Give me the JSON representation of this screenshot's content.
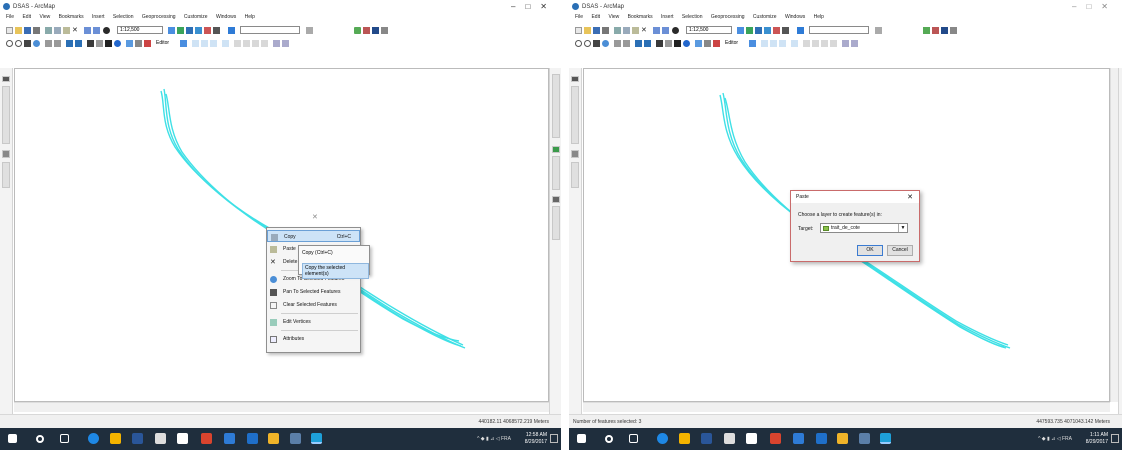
{
  "left": {
    "window": {
      "title": "DSAS - ArcMap"
    },
    "menu": [
      "File",
      "Edit",
      "View",
      "Bookmarks",
      "Insert",
      "Selection",
      "Geoprocessing",
      "Customize",
      "Windows",
      "Help"
    ],
    "toolbar": {
      "scale": "1:12,500",
      "editor_label": "Editor"
    },
    "context_menu": {
      "items": [
        {
          "label": "Copy",
          "shortcut": "Ctrl+C",
          "icon": "copy-icon"
        },
        {
          "label": "Paste",
          "icon": "paste-icon"
        },
        {
          "label": "Delete",
          "icon": "delete-icon"
        },
        {
          "label": "Zoom To Selected Features",
          "icon": "zoom-to-selected-icon"
        },
        {
          "label": "Pan To Selected Features",
          "icon": "pan-to-selected-icon"
        },
        {
          "label": "Clear Selected Features",
          "icon": "clear-selection-icon"
        },
        {
          "label": "Edit Vertices",
          "icon": "edit-vertices-icon"
        },
        {
          "label": "Attributes",
          "icon": "attributes-icon"
        }
      ]
    },
    "tooltip": {
      "title": "Copy (Ctrl+C)",
      "description": "Copy the selected element(s)"
    },
    "status": {
      "coordinates": "440182.11 4068572.219 Meters"
    },
    "taskbar": {
      "time": "12:58 AM",
      "date": "8/29/2017",
      "lang": "FRA"
    }
  },
  "right": {
    "window": {
      "title": "DSAS - ArcMap"
    },
    "menu": [
      "File",
      "Edit",
      "View",
      "Bookmarks",
      "Insert",
      "Selection",
      "Geoprocessing",
      "Customize",
      "Windows",
      "Help"
    ],
    "toolbar": {
      "scale": "1:12,500",
      "editor_label": "Editor"
    },
    "paste_dialog": {
      "title": "Paste",
      "prompt": "Choose a layer to create feature(s) in:",
      "target_label": "Target:",
      "target_value": "trait_de_cote",
      "ok": "OK",
      "cancel": "Cancel"
    },
    "status": {
      "selected": "Number of features selected: 3",
      "coordinates": "447593.735 4071043.142 Meters"
    },
    "taskbar": {
      "time": "1:11 AM",
      "date": "8/29/2017",
      "lang": "FRA"
    }
  },
  "colors": {
    "shoreline": "#3fe0e6",
    "taskbar": "#1f2e3d",
    "highlight": "#cde3f7",
    "dialog_border": "#c96b6b"
  }
}
